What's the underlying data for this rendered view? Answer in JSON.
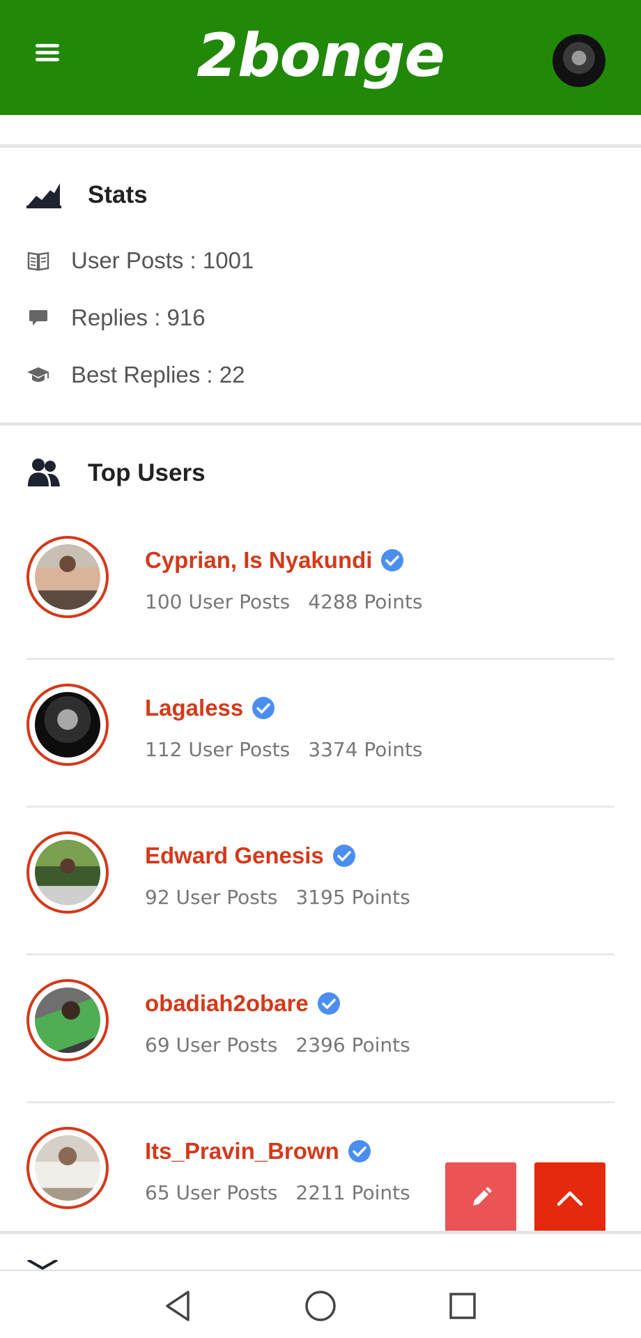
{
  "header": {
    "logo": "2bonge",
    "menu_icon": "hamburger-icon",
    "avatar": "profile-avatar"
  },
  "stats": {
    "title": "Stats",
    "rows": [
      {
        "icon": "book-icon",
        "label": "User Posts : 1001"
      },
      {
        "icon": "comment-icon",
        "label": "Replies : 916"
      },
      {
        "icon": "graduation-cap-icon",
        "label": "Best Replies : 22"
      }
    ]
  },
  "top_users": {
    "title": "Top Users",
    "users": [
      {
        "name": "Cyprian, Is Nyakundi",
        "posts": "100 User Posts",
        "points": "4288 Points"
      },
      {
        "name": "Lagaless",
        "posts": "112 User Posts",
        "points": "3374 Points"
      },
      {
        "name": "Edward Genesis",
        "posts": "92 User Posts",
        "points": "3195 Points"
      },
      {
        "name": "obadiah2obare",
        "posts": "69 User Posts",
        "points": "2396 Points"
      },
      {
        "name": "Its_Pravin_Brown",
        "posts": "65 User Posts",
        "points": "2211 Points"
      }
    ]
  },
  "colors": {
    "header_bg": "#228808",
    "accent": "#d4391a",
    "verified": "#4a8ef0",
    "fab_edit": "#ea5455",
    "fab_up": "#e5290c"
  },
  "fabs": {
    "edit_icon": "pencil-icon",
    "up_icon": "chevron-up-icon"
  },
  "navbar": {
    "back_icon": "back-triangle-icon",
    "home_icon": "home-circle-icon",
    "recents_icon": "recents-square-icon"
  }
}
